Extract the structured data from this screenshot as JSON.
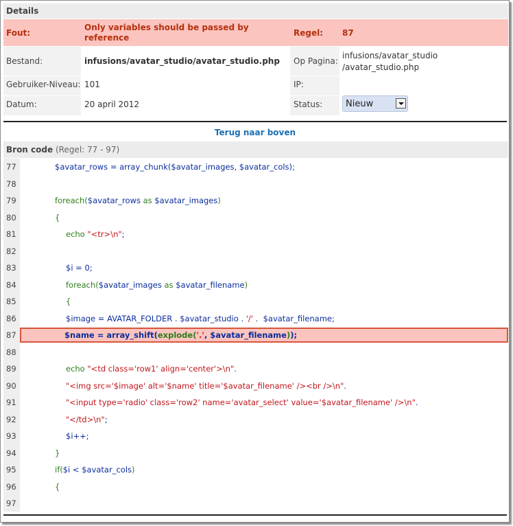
{
  "details": {
    "title": "Details",
    "error_label": "Fout:",
    "error_message": "Only variables should be passed by reference",
    "line_label": "Regel:",
    "line_value": "87",
    "file_label": "Bestand:",
    "file_value": "infusions/avatar_studio/avatar_studio.php",
    "page_label": "Op Pagina:",
    "page_link_line1": "infusions/avatar_studio",
    "page_link_line2": "/avatar_studio.php",
    "user_level_label": "Gebruiker-Niveau:",
    "user_level_value": "101",
    "ip_label": "IP:",
    "ip_value": "",
    "date_label": "Datum:",
    "date_value": "20 april 2012",
    "status_label": "Status:",
    "status_value": "Nieuw"
  },
  "back_link": "Terug naar boven",
  "source": {
    "title": "Bron code",
    "range": "(Regel: 77 - 97)",
    "highlighted_line": 87,
    "lines": [
      {
        "n": "77",
        "indent": 1,
        "parts": [
          [
            "v",
            "$avatar_rows"
          ],
          [
            "p",
            " = "
          ],
          [
            "p",
            "array_chunk("
          ],
          [
            "v",
            "$avatar_images"
          ],
          [
            "p",
            ", "
          ],
          [
            "v",
            "$avatar_cols"
          ],
          [
            "p",
            ");"
          ]
        ]
      },
      {
        "n": "78",
        "indent": 0,
        "parts": []
      },
      {
        "n": "79",
        "indent": 1,
        "parts": [
          [
            "k",
            "foreach("
          ],
          [
            "v",
            "$avatar_rows"
          ],
          [
            "k",
            " as "
          ],
          [
            "v",
            "$avatar_images"
          ],
          [
            "k",
            ")"
          ]
        ]
      },
      {
        "n": "80",
        "indent": 1,
        "parts": [
          [
            "k",
            "{"
          ]
        ]
      },
      {
        "n": "81",
        "indent": 2,
        "parts": [
          [
            "k",
            "echo "
          ],
          [
            "s",
            "\"<tr>\\n\""
          ],
          [
            "p",
            ";"
          ]
        ]
      },
      {
        "n": "82",
        "indent": 0,
        "parts": []
      },
      {
        "n": "83",
        "indent": 2,
        "parts": [
          [
            "v",
            "$i"
          ],
          [
            "p",
            " = 0;"
          ]
        ]
      },
      {
        "n": "84",
        "indent": 2,
        "parts": [
          [
            "k",
            "foreach("
          ],
          [
            "v",
            "$avatar_images"
          ],
          [
            "k",
            " as "
          ],
          [
            "v",
            "$avatar_filename"
          ],
          [
            "k",
            ")"
          ]
        ]
      },
      {
        "n": "85",
        "indent": 2,
        "parts": [
          [
            "k",
            "{"
          ]
        ]
      },
      {
        "n": "86",
        "indent": 2,
        "parts": [
          [
            "v",
            "$image"
          ],
          [
            "p",
            " = AVATAR_FOLDER . "
          ],
          [
            "v",
            "$avatar_studio"
          ],
          [
            "p",
            " . "
          ],
          [
            "s",
            "'/'"
          ],
          [
            "p",
            " .  "
          ],
          [
            "v",
            "$avatar_filename"
          ],
          [
            "p",
            ";"
          ]
        ]
      },
      {
        "n": "87",
        "indent": 2,
        "parts": [
          [
            "v",
            "$name"
          ],
          [
            "p",
            " = array_shift("
          ],
          [
            "k",
            "explode("
          ],
          [
            "s",
            "'.'"
          ],
          [
            "p",
            ", "
          ],
          [
            "v",
            "$avatar_filename"
          ],
          [
            "k",
            ")"
          ],
          [
            "p",
            ");"
          ]
        ]
      },
      {
        "n": "88",
        "indent": 0,
        "parts": []
      },
      {
        "n": "89",
        "indent": 2,
        "parts": [
          [
            "k",
            "echo "
          ],
          [
            "s",
            "\"<td class='row1' align='center'>\\n\""
          ],
          [
            "p",
            "."
          ]
        ]
      },
      {
        "n": "90",
        "indent": 2,
        "parts": [
          [
            "s",
            "\"<img src='$image' alt='$name' title='$avatar_filename' /><br />\\n\""
          ],
          [
            "p",
            "."
          ]
        ]
      },
      {
        "n": "91",
        "indent": 2,
        "parts": [
          [
            "s",
            "\"<input type='radio' class='row2' name='avatar_select' value='$avatar_filename' />\\n\""
          ],
          [
            "p",
            "."
          ]
        ]
      },
      {
        "n": "92",
        "indent": 2,
        "parts": [
          [
            "s",
            "\"</td>\\n\""
          ],
          [
            "p",
            ";"
          ]
        ]
      },
      {
        "n": "93",
        "indent": 2,
        "parts": [
          [
            "v",
            "$i"
          ],
          [
            "p",
            "++;"
          ]
        ]
      },
      {
        "n": "94",
        "indent": 1,
        "parts": [
          [
            "k",
            "}"
          ]
        ]
      },
      {
        "n": "95",
        "indent": 1,
        "parts": [
          [
            "k",
            "if("
          ],
          [
            "v",
            "$i"
          ],
          [
            "p",
            " < "
          ],
          [
            "v",
            "$avatar_cols"
          ],
          [
            "k",
            ")"
          ]
        ]
      },
      {
        "n": "96",
        "indent": 1,
        "parts": [
          [
            "k",
            "{"
          ]
        ]
      },
      {
        "n": "97",
        "indent": 0,
        "parts": []
      }
    ]
  }
}
